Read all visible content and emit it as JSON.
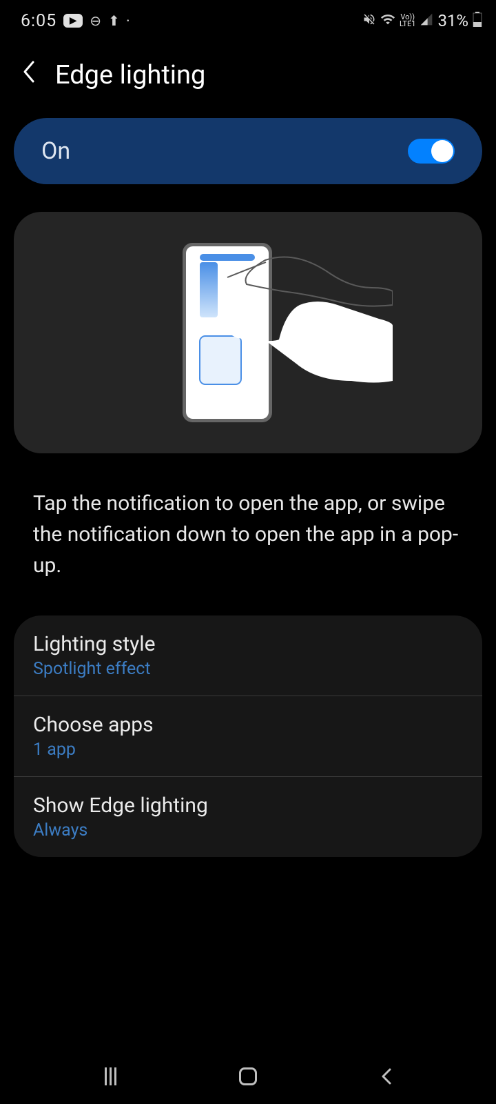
{
  "status": {
    "time": "6:05",
    "battery": "31%",
    "lte": "LTE1",
    "vo": "Vo))"
  },
  "header": {
    "title": "Edge lighting"
  },
  "toggle": {
    "label": "On",
    "state": true
  },
  "description": "Tap the notification to open the app, or swipe the notification down to open the app in a pop-up.",
  "settings": [
    {
      "title": "Lighting style",
      "value": "Spotlight effect"
    },
    {
      "title": "Choose apps",
      "value": "1 app"
    },
    {
      "title": "Show Edge lighting",
      "value": "Always"
    }
  ]
}
